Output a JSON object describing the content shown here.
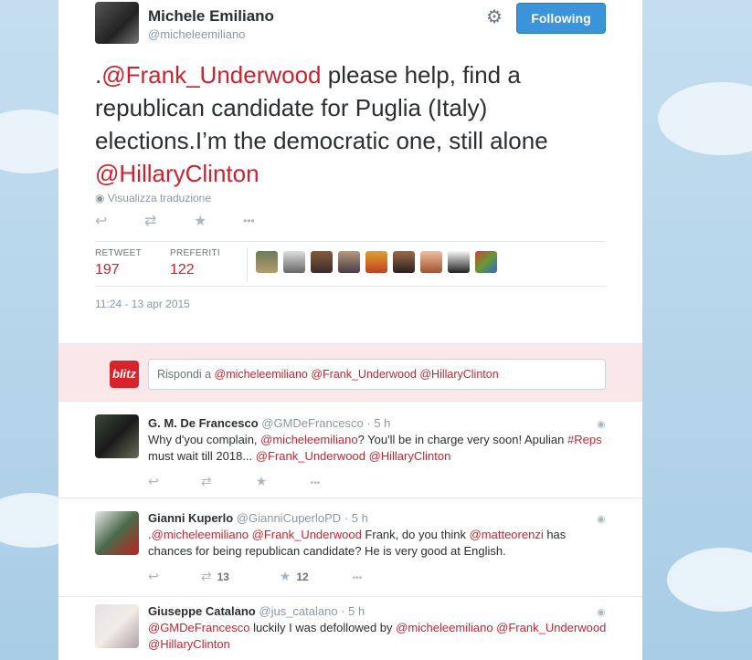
{
  "tweet": {
    "author_name": "Michele Emiliano",
    "author_handle": "@micheleemiliano",
    "follow_label": "Following",
    "text_prefix": ".",
    "mention_1": "@Frank_Underwood",
    "text_body": " please help, find a republican candidate for Puglia (Italy) elections.I’m the democratic one, still alone ",
    "mention_2": "@HillaryClinton",
    "translate_label": "Visualizza traduzione",
    "retweet_label": "RETWEET",
    "retweet_count": "197",
    "favorites_label": "PREFERITI",
    "favorites_count": "122",
    "timestamp": "11:24 - 13 apr 2015"
  },
  "reply_box": {
    "logo_text": "blitz",
    "prefix": "Rispondi a ",
    "mentions": "@micheleemiliano @Frank_Underwood @HillaryClinton"
  },
  "replies": [
    {
      "name": "G. M. De Francesco",
      "handle": "@GMDeFrancesco",
      "time": "5 h",
      "t1": "Why d'you complain, ",
      "m1": "@micheleemiliano",
      "t2": "? You'll be in charge very soon! Apulian ",
      "m2": "#Reps",
      "t3": " must wait till 2018... ",
      "m3": "@Frank_Underwood",
      "m4": "@HillaryClinton"
    },
    {
      "name": "Gianni Kuperlo",
      "handle": "@GianniCuperloPD",
      "time": "5 h",
      "t1": ".",
      "m1": "@micheleemiliano",
      "m2": "@Frank_Underwood",
      "t2": " Frank, do you think ",
      "m3": "@matteorenzi",
      "t3": " has chances for being republican candidate? He is very good at English.",
      "retweets": "13",
      "favorites": "12"
    },
    {
      "name": "Giuseppe Catalano",
      "handle": "@jus_catalano",
      "time": "5 h",
      "m1": "@GMDeFrancesco",
      "t1": " luckily I was defollowed  by ",
      "m2": "@micheleemiliano",
      "m3": "@Frank_Underwood",
      "m4": "@HillaryClinton"
    }
  ],
  "icons": {
    "reply": "↩",
    "retweet": "⇄",
    "favorite": "★",
    "more": "•••",
    "gear": "⚙",
    "globe": "◉"
  },
  "colors": {
    "link": "#c9232f",
    "follow_button": "#3b94d9",
    "reply_area": "#f9e7ea"
  }
}
